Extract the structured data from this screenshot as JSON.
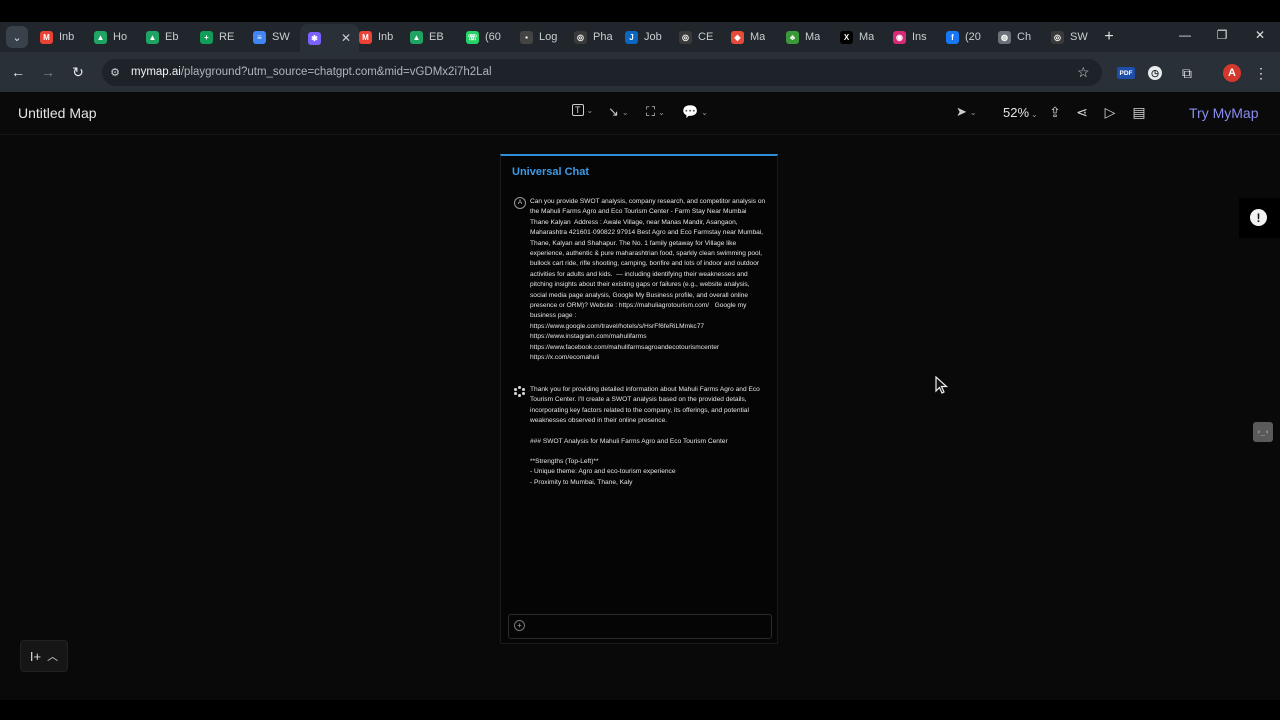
{
  "browser": {
    "tabs": [
      {
        "label": "Inb",
        "icon": "gmail-icon",
        "color": "#ea4335",
        "glyph": "M"
      },
      {
        "label": "Ho",
        "icon": "google-drive-icon",
        "color": "#1fa463",
        "glyph": "▲"
      },
      {
        "label": "Eb",
        "icon": "google-drive-icon",
        "color": "#1fa463",
        "glyph": "▲"
      },
      {
        "label": "RE",
        "icon": "google-sheets-icon",
        "color": "#0f9d58",
        "glyph": "+"
      },
      {
        "label": "SW",
        "icon": "google-docs-icon",
        "color": "#4285f4",
        "glyph": "≡"
      },
      {
        "label": "",
        "icon": "mymap-icon",
        "color": "#7b61ff",
        "glyph": "✱",
        "active": true
      },
      {
        "label": "Inb",
        "icon": "gmail-icon",
        "color": "#ea4335",
        "glyph": "M"
      },
      {
        "label": "EB",
        "icon": "google-drive-icon",
        "color": "#1fa463",
        "glyph": "▲"
      },
      {
        "label": "(60",
        "icon": "whatsapp-icon",
        "color": "#25d366",
        "glyph": "☏"
      },
      {
        "label": "Log",
        "icon": "notion-icon",
        "color": "#444444",
        "glyph": "▪"
      },
      {
        "label": "Pha",
        "icon": "chatgpt-icon",
        "color": "#3a3a3a",
        "glyph": "◎"
      },
      {
        "label": "Job",
        "icon": "job-site-icon",
        "color": "#0a66c2",
        "glyph": "J"
      },
      {
        "label": "CE",
        "icon": "chatgpt-icon",
        "color": "#3a3a3a",
        "glyph": "◎"
      },
      {
        "label": "Ma",
        "icon": "maps-app-icon",
        "color": "#e54a3a",
        "glyph": "◆"
      },
      {
        "label": "Ma",
        "icon": "tree-icon",
        "color": "#3a9a3a",
        "glyph": "♣"
      },
      {
        "label": "Ma",
        "icon": "x-twitter-icon",
        "color": "#000000",
        "glyph": "X"
      },
      {
        "label": "Ins",
        "icon": "instagram-icon",
        "color": "#d62976",
        "glyph": "◉"
      },
      {
        "label": "(20",
        "icon": "facebook-icon",
        "color": "#1877f2",
        "glyph": "f"
      },
      {
        "label": "Ch",
        "icon": "chrome-icon",
        "color": "#6b7178",
        "glyph": "◍"
      },
      {
        "label": "SW",
        "icon": "chatgpt-icon",
        "color": "#3a3a3a",
        "glyph": "◎"
      }
    ],
    "url_host": "mymap.ai",
    "url_rest": "/playground?utm_source=chatgpt.com&mid=vGDMx2i7h2Lal",
    "pdf_ext_label": "PDF",
    "avatar_letter": "A"
  },
  "app": {
    "title": "Untitled Map",
    "zoom": "52%",
    "try_label": "Try MyMap"
  },
  "chat": {
    "title": "Universal Chat",
    "user_initial": "A",
    "user_message": "Can you provide SWOT analysis, company research, and competitor analysis on the Mahuli Farms Agro and Eco Tourism Center - Farm Stay Near Mumbai Thane Kalyan  Address : Awale Village, near Manas Mandir, Asangaon, Maharashtra 421601·090822 97914 Best Agro and Eco Farmstay near Mumbai, Thane, Kalyan and Shahapur. The No. 1 family getaway for Village like experience, authentic & pure maharashtrian food, sparkly clean swimming pool, bullock cart ride, rifle shooting, camping, bonfire and lots of indoor and outdoor activities for adults and kids.  — including identifying their weaknesses and pitching insights about their existing gaps or failures (e.g., website analysis, social media page analysis, Google My Business profile, and overall online presence or ORM)? Website : https://mahuliagrotourism.com/   Google my business page :\nhttps://www.google.com/travel/hotels/s/HsrFf6feRiLMmkc77\nhttps://www.instagram.com/mahulifarms\nhttps://www.facebook.com/mahulifarmsagroandecotourismcenter\nhttps://x.com/ecomahuli",
    "ai_intro": "Thank you for providing detailed information about Mahuli Farms Agro and Eco Tourism Center. I'll create a SWOT analysis based on the provided details, incorporating key factors related to the company, its offerings, and potential weaknesses observed in their online presence.",
    "ai_heading": "### SWOT Analysis for Mahuli Farms Agro and Eco Tourism Center",
    "ai_strengths": "**Strengths (Top-Left)**\n- Unique theme: Agro and eco-tourism experience\n- Proximity to Mumbai, Thane, Kaly",
    "input_value": ""
  },
  "widgets": {
    "feedback_glyph": "!",
    "code_glyph": "›_‹"
  }
}
